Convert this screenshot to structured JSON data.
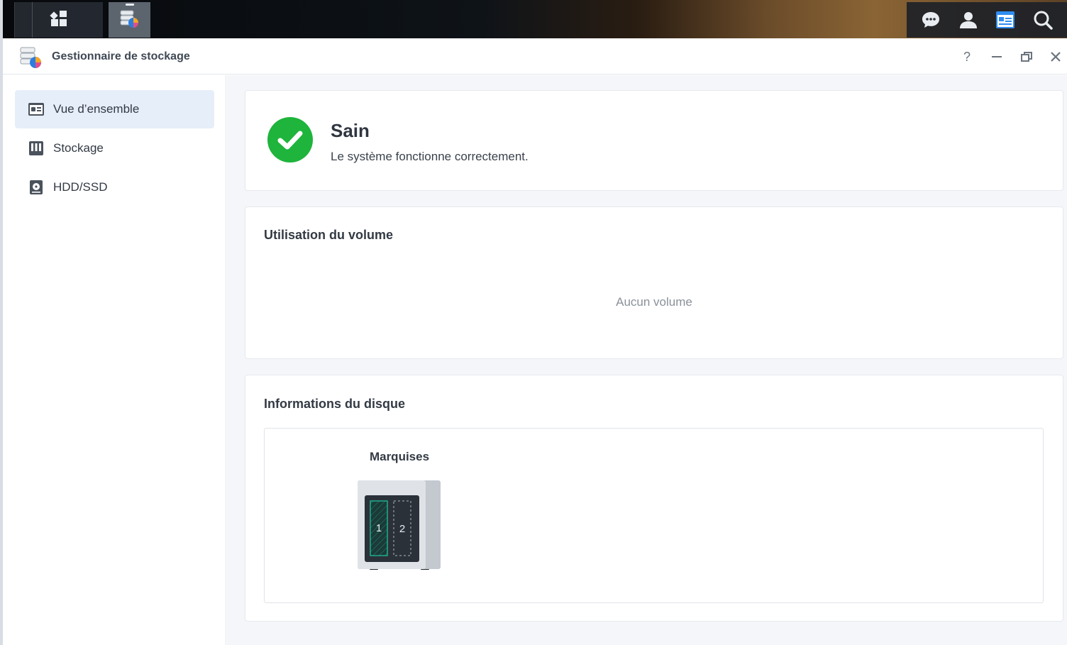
{
  "taskbar": {
    "icons": [
      "main-menu-icon",
      "storage-manager-icon",
      "chat-icon",
      "user-icon",
      "widgets-icon",
      "search-icon"
    ],
    "accent": "#2f8cf0"
  },
  "window": {
    "title": "Gestionnaire de stockage",
    "controls": [
      "help-icon",
      "minimize-icon",
      "restore-icon",
      "close-icon"
    ],
    "help_label": "?"
  },
  "sidebar": {
    "items": [
      {
        "label": "Vue d’ensemble",
        "icon": "overview-icon",
        "active": true
      },
      {
        "label": "Stockage",
        "icon": "storage-icon",
        "active": false
      },
      {
        "label": "HDD/SSD",
        "icon": "hdd-icon",
        "active": false
      }
    ]
  },
  "status": {
    "title": "Sain",
    "description": "Le système fonctionne correctement.",
    "icon": "check-circle-icon",
    "color": "#1fb43c"
  },
  "volume_usage": {
    "title": "Utilisation du volume",
    "empty_text": "Aucun volume"
  },
  "disk_info": {
    "title": "Informations du disque",
    "device": {
      "name": "Marquises",
      "bays": [
        {
          "label": "1",
          "occupied": true,
          "color": "#1ec8a0"
        },
        {
          "label": "2",
          "occupied": false
        }
      ]
    }
  }
}
